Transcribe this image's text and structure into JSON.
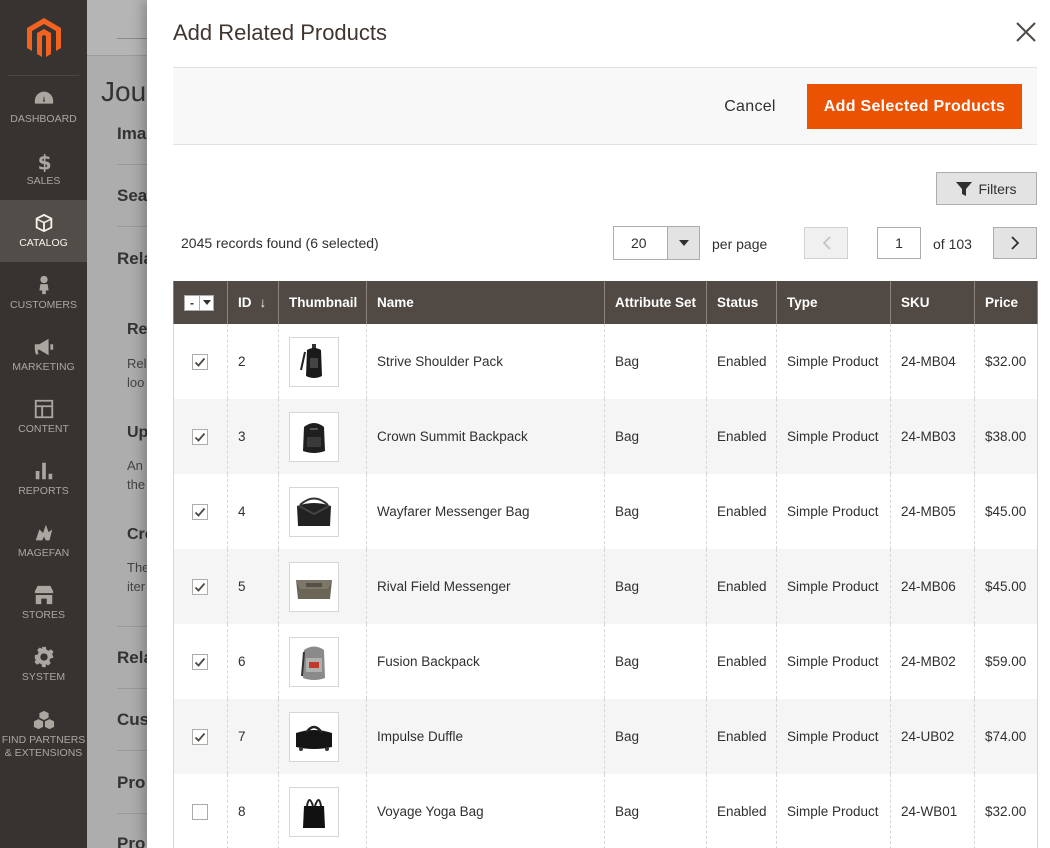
{
  "sidebar": {
    "items": [
      {
        "label": "DASHBOARD",
        "icon": "dashboard-icon",
        "active": false
      },
      {
        "label": "SALES",
        "icon": "dollar-icon",
        "active": false
      },
      {
        "label": "CATALOG",
        "icon": "box-icon",
        "active": true
      },
      {
        "label": "CUSTOMERS",
        "icon": "person-icon",
        "active": false
      },
      {
        "label": "MARKETING",
        "icon": "megaphone-icon",
        "active": false
      },
      {
        "label": "CONTENT",
        "icon": "layout-icon",
        "active": false
      },
      {
        "label": "REPORTS",
        "icon": "bar-chart-icon",
        "active": false
      },
      {
        "label": "MAGEFAN",
        "icon": "magefan-icon",
        "active": false
      },
      {
        "label": "STORES",
        "icon": "store-icon",
        "active": false
      },
      {
        "label": "SYSTEM",
        "icon": "gear-icon",
        "active": false
      },
      {
        "label": "FIND PARTNERS & EXTENSIONS",
        "icon": "extensions-icon",
        "active": false
      }
    ]
  },
  "background": {
    "title": "Jous",
    "sections": [
      "Ima",
      "Sea",
      "Rela",
      "Rela",
      "Cus",
      "Pro",
      "Pro"
    ],
    "subs": [
      {
        "heading": "Re",
        "lines": [
          "Rel",
          "loo"
        ]
      },
      {
        "heading": "Up",
        "lines": [
          "An",
          "the"
        ]
      },
      {
        "heading": "Cro",
        "lines": [
          "The",
          "iter"
        ]
      }
    ]
  },
  "modal": {
    "title": "Add Related Products",
    "cancel_label": "Cancel",
    "add_label": "Add Selected Products",
    "filters_label": "Filters",
    "records_text": "2045 records found (6 selected)",
    "per_page_value": "20",
    "per_page_label": "per page",
    "page_current": "1",
    "page_of": "of 103",
    "mass_select_symbol": "-"
  },
  "grid": {
    "columns": [
      "ID",
      "Thumbnail",
      "Name",
      "Attribute Set",
      "Status",
      "Type",
      "SKU",
      "Price"
    ],
    "sort_indicator": "↓",
    "rows": [
      {
        "checked": true,
        "id": "2",
        "name": "Strive Shoulder Pack",
        "attr": "Bag",
        "status": "Enabled",
        "type": "Simple Product",
        "sku": "24-MB04",
        "price": "$32.00"
      },
      {
        "checked": true,
        "id": "3",
        "name": "Crown Summit Backpack",
        "attr": "Bag",
        "status": "Enabled",
        "type": "Simple Product",
        "sku": "24-MB03",
        "price": "$38.00"
      },
      {
        "checked": true,
        "id": "4",
        "name": "Wayfarer Messenger Bag",
        "attr": "Bag",
        "status": "Enabled",
        "type": "Simple Product",
        "sku": "24-MB05",
        "price": "$45.00"
      },
      {
        "checked": true,
        "id": "5",
        "name": "Rival Field Messenger",
        "attr": "Bag",
        "status": "Enabled",
        "type": "Simple Product",
        "sku": "24-MB06",
        "price": "$45.00"
      },
      {
        "checked": true,
        "id": "6",
        "name": "Fusion Backpack",
        "attr": "Bag",
        "status": "Enabled",
        "type": "Simple Product",
        "sku": "24-MB02",
        "price": "$59.00"
      },
      {
        "checked": true,
        "id": "7",
        "name": "Impulse Duffle",
        "attr": "Bag",
        "status": "Enabled",
        "type": "Simple Product",
        "sku": "24-UB02",
        "price": "$74.00"
      },
      {
        "checked": false,
        "id": "8",
        "name": "Voyage Yoga Bag",
        "attr": "Bag",
        "status": "Enabled",
        "type": "Simple Product",
        "sku": "24-WB01",
        "price": "$32.00"
      }
    ]
  },
  "colors": {
    "accent": "#eb5202",
    "sidebar_bg": "#373330",
    "grid_header_bg": "#514943"
  }
}
